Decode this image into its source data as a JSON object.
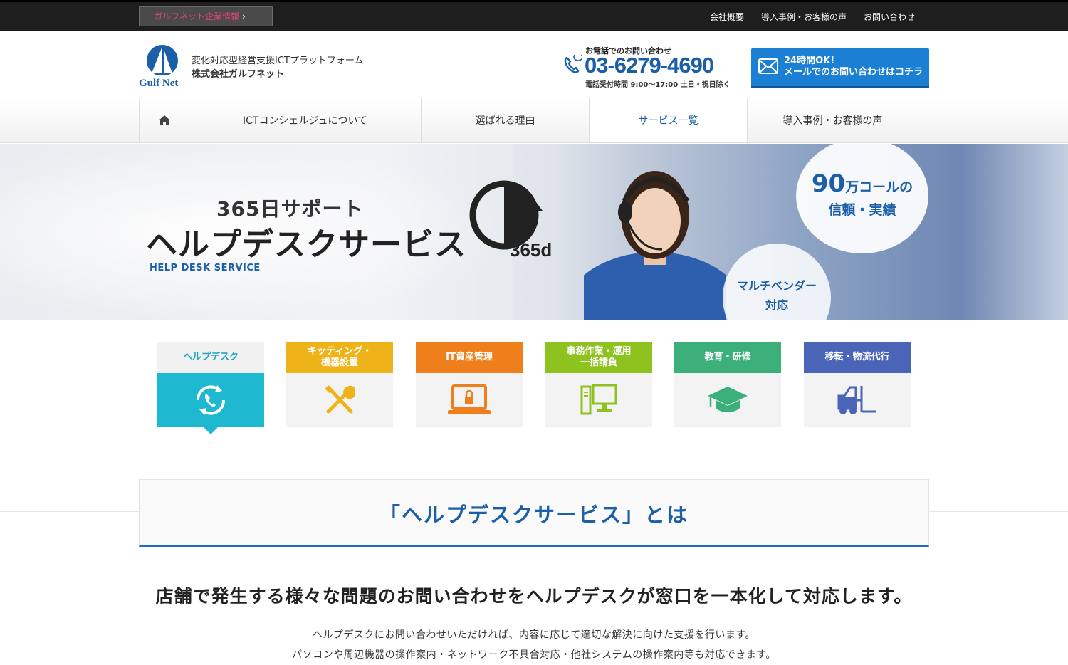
{
  "topbar": {
    "corp_link": "ガルフネット企業情報",
    "links": [
      "会社概要",
      "導入事例・お客様の声",
      "お問い合わせ"
    ]
  },
  "header": {
    "logo_text": "Gulf Net",
    "tagline": "変化対応型経営支援ICTプラットフォーム",
    "company": "株式会社ガルフネット",
    "phone_label": "お電話でのお問い合わせ",
    "phone_number": "03-6279-4690",
    "phone_hours": "電話受付時間 9:00～17:00 土日・祝日除く",
    "mail_line1": "24時間OK!",
    "mail_line2": "メールでのお問い合わせはコチラ"
  },
  "nav": {
    "items": [
      "ICTコンシェルジュについて",
      "選ばれる理由",
      "サービス一覧",
      "導入事例・お客様の声"
    ],
    "active_index": 2
  },
  "hero": {
    "small_title": "365日サポート",
    "big_title": "ヘルプデスクサービス",
    "en_title": "HELP DESK SERVICE",
    "badge_365": "365d",
    "bubble1_num": "90",
    "bubble1_unit": "万コールの",
    "bubble1_line2": "信頼・実績",
    "bubble2_line1": "マルチベンダー",
    "bubble2_line2": "対応"
  },
  "tiles": [
    {
      "label": "ヘルプデスク",
      "color": "#1eb8d1",
      "icon": "phone-cycle-icon",
      "active": true
    },
    {
      "label": "キッティング・\n機器設置",
      "color": "#efb31a",
      "icon": "tools-icon",
      "active": false
    },
    {
      "label": "IT資産管理",
      "color": "#ef7f1a",
      "icon": "laptop-lock-icon",
      "active": false
    },
    {
      "label": "事務作業・運用\n一括請負",
      "color": "#8dc21f",
      "icon": "desktop-pc-icon",
      "active": false
    },
    {
      "label": "教育・研修",
      "color": "#3daf7a",
      "icon": "graduation-cap-icon",
      "active": false
    },
    {
      "label": "移転・物流代行",
      "color": "#4a64b8",
      "icon": "forklift-icon",
      "active": false
    }
  ],
  "section": {
    "title": "「ヘルプデスクサービス」とは",
    "lead": "店舗で発生する様々な問題のお問い合わせをヘルプデスクが窓口を一本化して対応します。",
    "body_line1": "ヘルプデスクにお問い合わせいただければ、内容に応じて適切な解決に向けた支援を行います。",
    "body_line2": "パソコンや周辺機器の操作案内・ネットワーク不具合対応・他社システムの操作案内等も対応できます。"
  },
  "colors": {
    "brand_blue": "#1b5fa8",
    "mail_button": "#1b7fd4",
    "topbar": "#1e1e1e"
  }
}
